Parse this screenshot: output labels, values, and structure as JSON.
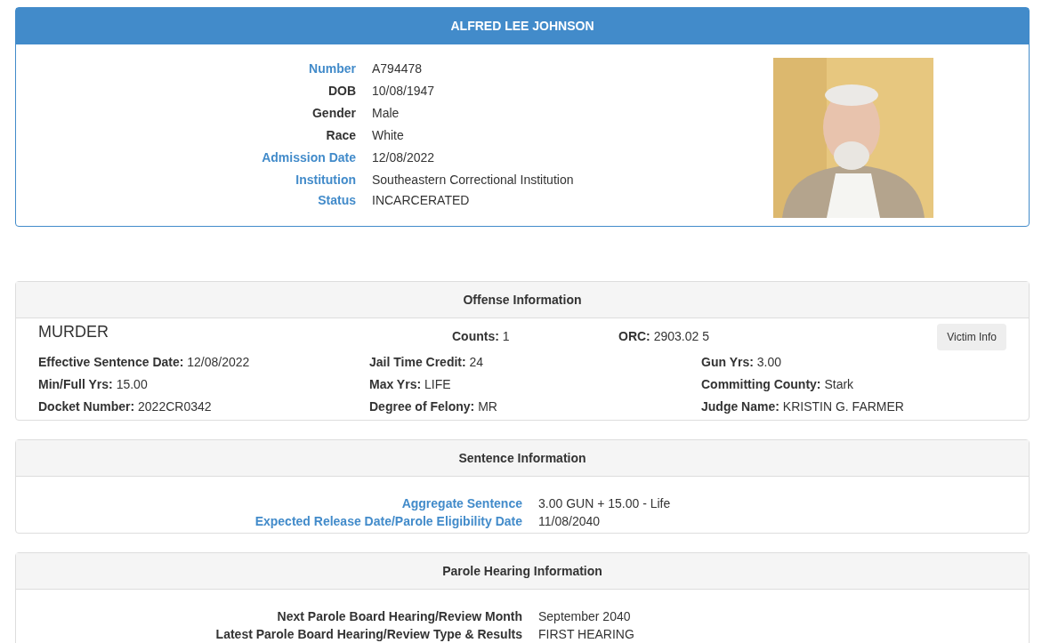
{
  "profile": {
    "name": "ALFRED LEE JOHNSON",
    "fields": [
      {
        "label": "Number",
        "value": "A794478",
        "kind": "link"
      },
      {
        "label": "DOB",
        "value": "10/08/1947",
        "kind": "plain"
      },
      {
        "label": "Gender",
        "value": "Male",
        "kind": "plain"
      },
      {
        "label": "Race",
        "value": "White",
        "kind": "plain"
      },
      {
        "label": "Admission Date",
        "value": "12/08/2022",
        "kind": "link"
      },
      {
        "label": "Institution",
        "value": "Southeastern Correctional Institution",
        "kind": "link"
      },
      {
        "label": "Status",
        "value": "INCARCERATED",
        "kind": "link"
      }
    ]
  },
  "offense": {
    "title": "Offense Information",
    "offense": "MURDER",
    "counts": {
      "label": "Counts:",
      "value": "1"
    },
    "orc": {
      "label": "ORC:",
      "value": "2903.02 5"
    },
    "button": "Victim Info",
    "details": [
      {
        "label": "Effective Sentence Date:",
        "value": "12/08/2022"
      },
      {
        "label": "Jail Time Credit:",
        "value": "24"
      },
      {
        "label": "Gun Yrs:",
        "value": "3.00"
      },
      {
        "label": "Min/Full Yrs:",
        "value": "15.00"
      },
      {
        "label": "Max Yrs:",
        "value": "LIFE"
      },
      {
        "label": "Committing County:",
        "value": "Stark"
      },
      {
        "label": "Docket Number:",
        "value": "2022CR0342"
      },
      {
        "label": "Degree of Felony:",
        "value": "MR"
      },
      {
        "label": "Judge Name:",
        "value": "KRISTIN G. FARMER"
      }
    ]
  },
  "sentence": {
    "title": "Sentence Information",
    "fields": [
      {
        "label": "Aggregate Sentence",
        "value": "3.00 GUN + 15.00 - Life",
        "kind": "link"
      },
      {
        "label": "Expected Release Date/Parole Eligibility Date",
        "value": "11/08/2040",
        "kind": "link"
      }
    ]
  },
  "parole": {
    "title": "Parole Hearing Information",
    "fields": [
      {
        "label": "Next Parole Board Hearing/Review Month",
        "value": "September 2040",
        "kind": "plain"
      },
      {
        "label": "Latest Parole Board Hearing/Review Type & Results",
        "value": "FIRST HEARING",
        "kind": "plain"
      }
    ]
  }
}
